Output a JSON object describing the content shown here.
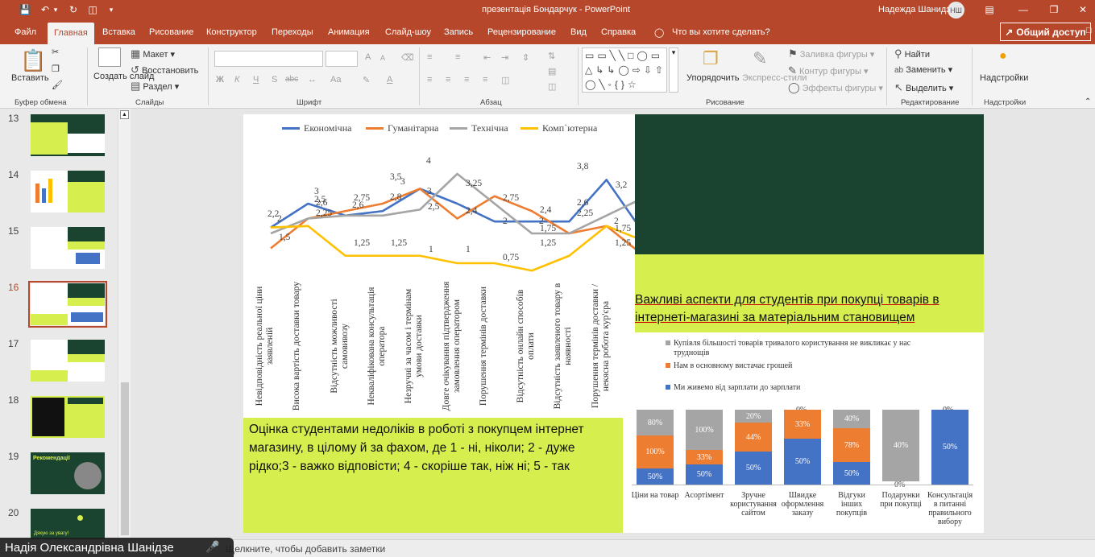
{
  "window": {
    "title": "презентація Бондарчук - PowerPoint",
    "user": "Надежда Шанидзе",
    "user_initials": "НШ"
  },
  "tabs": [
    "Файл",
    "Главная",
    "Вставка",
    "Рисование",
    "Конструктор",
    "Переходы",
    "Анимация",
    "Слайд-шоу",
    "Запись",
    "Рецензирование",
    "Вид",
    "Справка"
  ],
  "tell_me": "Что вы хотите сделать?",
  "share_label": "Общий доступ",
  "ribbon": {
    "paste": "Вставить",
    "clipboard_group": "Буфер обмена",
    "new_slide": "Создать слайд",
    "layout": "Макет",
    "reset": "Восстановить",
    "section": "Раздел",
    "slides_group": "Слайды",
    "font_bold": "Ж",
    "font_italic": "К",
    "font_underline": "Ч",
    "font_shadow": "S",
    "font_strike": "abc",
    "font_case": "Aa",
    "font_grow": "A",
    "font_shrink": "A",
    "font_group": "Шрифт",
    "paragraph_group": "Абзац",
    "arrange": "Упорядочить",
    "quick_styles": "Экспресс-стили",
    "shape_fill": "Заливка фигуры",
    "shape_outline": "Контур фигуры",
    "shape_effects": "Эффекты фигуры",
    "drawing_group": "Рисование",
    "find": "Найти",
    "replace": "Заменить",
    "select": "Выделить",
    "editing_group": "Редактирование",
    "addins": "Надстройки",
    "addins_group": "Надстройки"
  },
  "thumbnails": [
    {
      "num": "13"
    },
    {
      "num": "14"
    },
    {
      "num": "15"
    },
    {
      "num": "16",
      "selected": true
    },
    {
      "num": "17"
    },
    {
      "num": "18"
    },
    {
      "num": "19",
      "text": "Рекомендації"
    },
    {
      "num": "20",
      "text": "Дякую за увагу!"
    }
  ],
  "slide": {
    "caption_left": [
      "Оцінка студентами недоліків в роботі з покупцем інтернет",
      "магазину, в цілому й за фахом, де 1 - ні, ніколи; 2 - дуже",
      "рідко;3 - важко відповісти; 4 - скоріше так, ніж ні; 5 - так"
    ],
    "caption_right": [
      "Важливі аспекти для студентів при покупці товарів в",
      "інтернеті-магазині за матеріальним становищем"
    ]
  },
  "chart_data": [
    {
      "type": "line",
      "series": [
        {
          "name": "Економічна",
          "color": "#4472c4",
          "values": [
            2.2,
            3,
            2.6,
            2.75,
            3.5,
            3,
            2.4,
            2.4,
            2.4,
            3.8,
            2
          ]
        },
        {
          "name": "Гуманітарна",
          "color": "#ed7d31",
          "values": [
            1.5,
            2.5,
            2.75,
            3,
            3.5,
            2.5,
            3.25,
            2.75,
            2,
            2.25,
            1.25
          ]
        },
        {
          "name": "Технічна",
          "color": "#a5a5a5",
          "values": [
            2,
            2.5,
            2.6,
            2.6,
            2.8,
            4,
            3,
            2,
            2,
            2.6,
            3.2
          ]
        },
        {
          "name": "Комп`ютерна",
          "color": "#ffc000",
          "values": [
            2.2,
            2.25,
            1.25,
            1.25,
            1.25,
            1,
            1,
            0.75,
            1.25,
            2.25,
            1.75
          ]
        }
      ],
      "categories": [
        "Невідповідність реальної ціни заявленій",
        "Висока вартість доставки товару",
        "Відсутність можливості самовивозу",
        "Некваліфікована консультація оператора",
        "Незручні за часом і термінам умови доставки",
        "Довге очікування підтвердження замовлення оператором",
        "Порушення термінів доставки",
        "Відсутність онлайн способів оплати",
        "Відсутність заявленого товару в наявності",
        "Порушення термінів доставки / некясна робота кур'єра"
      ],
      "data_labels": [
        {
          "text": "2,2",
          "x": 30,
          "y": 127
        },
        {
          "text": "2",
          "x": 42,
          "y": 133
        },
        {
          "text": "1,5",
          "x": 44,
          "y": 156
        },
        {
          "text": "3",
          "x": 88,
          "y": 99
        },
        {
          "text": "2,6",
          "x": 90,
          "y": 113
        },
        {
          "text": "2,5",
          "x": 88,
          "y": 109
        },
        {
          "text": "2,25",
          "x": 90,
          "y": 126
        },
        {
          "text": "2,75",
          "x": 137,
          "y": 107
        },
        {
          "text": "2,6",
          "x": 135,
          "y": 116
        },
        {
          "text": "1,25",
          "x": 137,
          "y": 163
        },
        {
          "text": "3,5",
          "x": 182,
          "y": 81
        },
        {
          "text": "3",
          "x": 195,
          "y": 87
        },
        {
          "text": "2,8",
          "x": 182,
          "y": 106
        },
        {
          "text": "1,25",
          "x": 183,
          "y": 163
        },
        {
          "text": "4",
          "x": 227,
          "y": 61
        },
        {
          "text": "3",
          "x": 228,
          "y": 99
        },
        {
          "text": "2,5",
          "x": 229,
          "y": 118
        },
        {
          "text": "1",
          "x": 230,
          "y": 171
        },
        {
          "text": "3,25",
          "x": 276,
          "y": 89
        },
        {
          "text": "2,4",
          "x": 276,
          "y": 123
        },
        {
          "text": "1",
          "x": 276,
          "y": 171
        },
        {
          "text": "2,75",
          "x": 322,
          "y": 107
        },
        {
          "text": "2",
          "x": 322,
          "y": 136
        },
        {
          "text": "0,75",
          "x": 322,
          "y": 181
        },
        {
          "text": "2,4",
          "x": 368,
          "y": 122
        },
        {
          "text": "2",
          "x": 367,
          "y": 136
        },
        {
          "text": "1,75",
          "x": 368,
          "y": 145
        },
        {
          "text": "1,25",
          "x": 368,
          "y": 163
        },
        {
          "text": "3,8",
          "x": 414,
          "y": 68
        },
        {
          "text": "2,6",
          "x": 414,
          "y": 113
        },
        {
          "text": "2,25",
          "x": 414,
          "y": 126
        },
        {
          "text": "3,2",
          "x": 462,
          "y": 91
        },
        {
          "text": "2",
          "x": 460,
          "y": 136
        },
        {
          "text": "1,75",
          "x": 461,
          "y": 145
        },
        {
          "text": "1,25",
          "x": 461,
          "y": 163
        }
      ]
    },
    {
      "type": "bar",
      "stacked": true,
      "series_legend": [
        {
          "name": "Купівля більшості товарів тривалого користування не викликає у нас труднощів",
          "color": "#a5a5a5"
        },
        {
          "name": "Нам в основному вистачає грошей",
          "color": "#ed7d31"
        },
        {
          "name": "Ми живемо від зарплати до зарплати",
          "color": "#4472c4"
        }
      ],
      "categories": [
        "Ціни на товар",
        "Асортімент",
        "Зручне користування сайтом",
        "Швидке оформлення заказу",
        "Відгуки інших покупців",
        "Подарунки при покупці",
        "Консультація в питанні правильного вибору"
      ],
      "bars": [
        {
          "blue": "50%",
          "orange": "100%",
          "gray": "80%"
        },
        {
          "blue": "50%",
          "orange": "33%",
          "gray": "100%"
        },
        {
          "blue": "50%",
          "orange": "44%",
          "gray": "20%"
        },
        {
          "blue": "50%",
          "orange": "33%",
          "gray": "0%"
        },
        {
          "blue": "50%",
          "orange": "78%",
          "gray": "40%"
        },
        {
          "blue": "0%",
          "orange": "0%",
          "gray": "40%"
        },
        {
          "blue": "50%",
          "orange": "",
          "gray": "0%"
        }
      ]
    }
  ],
  "status": {
    "notes": "Щелкните, чтобы добавить заметки",
    "presenter": "Надія Олександрівна Шанідзе"
  }
}
